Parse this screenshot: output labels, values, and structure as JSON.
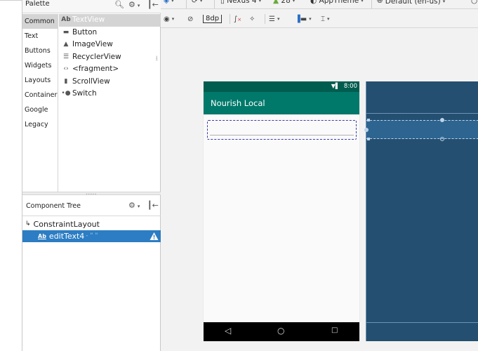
{
  "palette": {
    "title": "Palette",
    "categories": [
      {
        "label": "Common",
        "selected": true
      },
      {
        "label": "Text"
      },
      {
        "label": "Buttons"
      },
      {
        "label": "Widgets"
      },
      {
        "label": "Layouts"
      },
      {
        "label": "Containers"
      },
      {
        "label": "Google"
      },
      {
        "label": "Legacy"
      }
    ],
    "items": [
      {
        "icon": "Ab",
        "label": "TextView",
        "selected": true
      },
      {
        "icon": "▬",
        "label": "Button"
      },
      {
        "icon": "▲",
        "label": "ImageView"
      },
      {
        "icon": "☰",
        "label": "RecyclerView"
      },
      {
        "icon": "‹›",
        "label": "<fragment>"
      },
      {
        "icon": "▮",
        "label": "ScrollView"
      },
      {
        "icon": "•●",
        "label": "Switch"
      }
    ]
  },
  "component_tree": {
    "title": "Component Tree",
    "root": "ConstraintLayout",
    "child": {
      "icon": "Ab",
      "label": "editText4",
      "suffix": "- \" \""
    }
  },
  "toolbar1": {
    "device": "Nexus 4",
    "api": "28",
    "theme": "AppTheme",
    "locale": "Default (en-us)"
  },
  "toolbar2": {
    "margin": "8dp"
  },
  "phone": {
    "time": "8:00",
    "app_title": "Nourish Local"
  },
  "colors": {
    "status_bar": "#005c4e",
    "app_bar": "#00796b",
    "selection": "#2c7dc3",
    "blueprint": "#244f70",
    "arrow": "#e02020"
  }
}
